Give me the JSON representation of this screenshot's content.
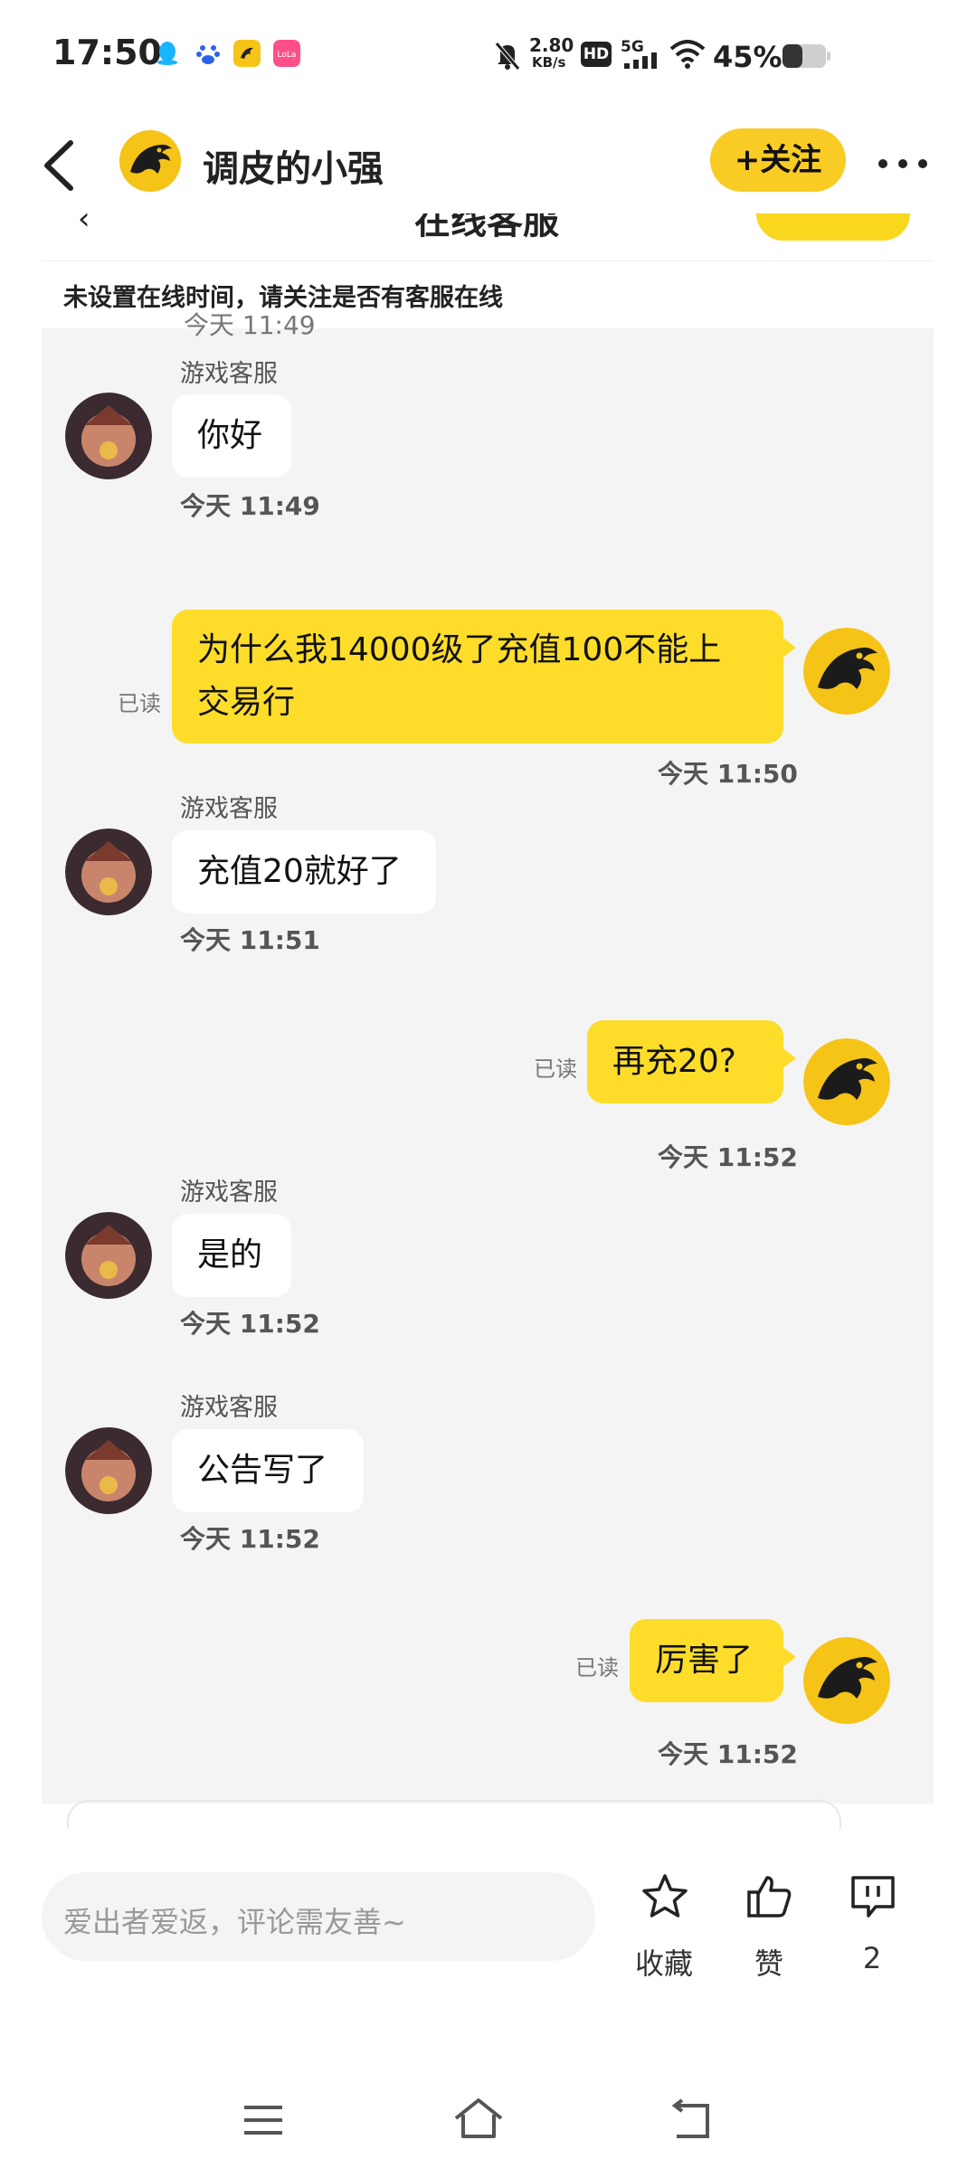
{
  "status_bar": {
    "time": "17:50",
    "net_speed_value": "2.80",
    "net_speed_unit": "KB/s",
    "hd": "HD",
    "signal": "5G",
    "battery": "45%"
  },
  "header": {
    "title": "调皮的小强",
    "follow_label": "+关注",
    "icons": [
      "back-arrow-icon",
      "more-icon"
    ]
  },
  "chat_screenshot": {
    "notice": "未设置在线时间，请关注是否有客服在线",
    "clipped_timestamp": "今天 11:49",
    "messages": [
      {
        "side": "left",
        "sender": "游戏客服",
        "text": "你好",
        "time": "今天 11:49"
      },
      {
        "side": "right",
        "line1": "为什么我14000级了充值100不能上",
        "line2": "交易行",
        "read": "已读",
        "time": "今天 11:50"
      },
      {
        "side": "left",
        "sender": "游戏客服",
        "text": "充值20就好了",
        "time": "今天 11:51"
      },
      {
        "side": "right",
        "text": "再充20?",
        "read": "已读",
        "time": "今天 11:52"
      },
      {
        "side": "left",
        "sender": "游戏客服",
        "text": "是的",
        "time": "今天 11:52"
      },
      {
        "side": "left",
        "sender": "游戏客服",
        "text": "公告写了",
        "time": "今天 11:52"
      },
      {
        "side": "right",
        "text": "厉害了",
        "read": "已读",
        "time": "今天 11:52"
      }
    ]
  },
  "comment_bar": {
    "placeholder": "爱出者爱返，评论需友善~",
    "favorite_label": "收藏",
    "like_label": "赞",
    "comment_count": "2"
  },
  "colors": {
    "accent": "#f8cc24",
    "my_bubble": "#fedd2a",
    "chat_bg": "#f4f4f4"
  }
}
